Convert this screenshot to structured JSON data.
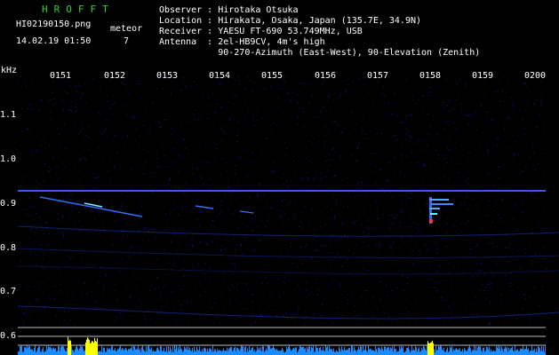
{
  "header": {
    "title": "HROFFT",
    "filename": "HI02190150.png",
    "meteor_label": "meteor",
    "meteor_count": "7",
    "datetime": "14.02.19 01:50",
    "info": {
      "observer": "Observer : Hirotaka Otsuka",
      "location": "Location : Hirakata, Osaka, Japan (135.7E, 34.9N)",
      "receiver": "Receiver : YAESU FT-690 53.749MHz, USB",
      "antenna": "Antenna  : 2el-HB9CV, 4m's high",
      "antenna2": "           90-270-Azimuth (East-West), 90-Elevation (Zenith)"
    }
  },
  "axis": {
    "unit": "kHz",
    "y_ticks": [
      "1.1",
      "1.0",
      "0.9",
      "0.8",
      "0.7",
      "0.6"
    ],
    "x_ticks": [
      "0151",
      "0152",
      "0153",
      "0154",
      "0155",
      "0156",
      "0157",
      "0158",
      "0159",
      "0200"
    ]
  },
  "colors": {
    "background": "#000000",
    "title": "#2fd42f",
    "signal": "#2a3dff",
    "grid": "#1c1cff",
    "meteor": "#9ef",
    "spectrum": "#ffff00"
  }
}
